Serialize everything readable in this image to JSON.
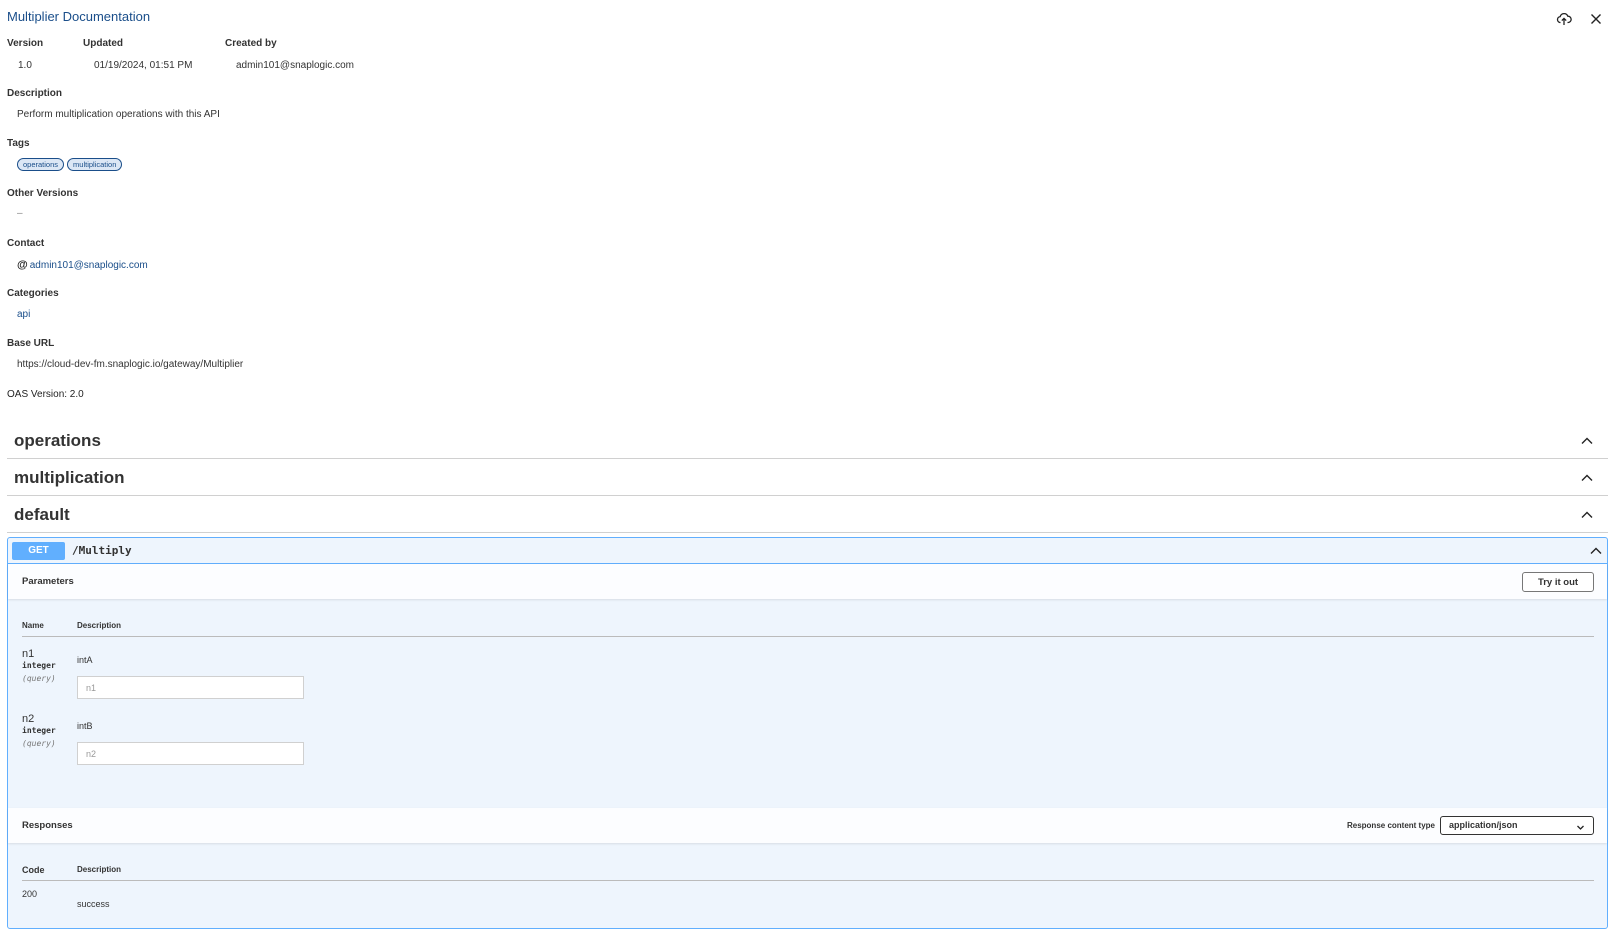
{
  "header": {
    "title": "Multiplier Documentation",
    "icons": [
      "cloud-upload-icon",
      "close-icon"
    ]
  },
  "meta": {
    "version_label": "Version",
    "version": "1.0",
    "updated_label": "Updated",
    "updated": "01/19/2024, 01:51 PM",
    "created_label": "Created by",
    "created_by": "admin101@snaplogic.com"
  },
  "description": {
    "label": "Description",
    "text": "Perform multiplication operations with this API"
  },
  "tags": {
    "label": "Tags",
    "items": [
      "operations",
      "multiplication"
    ]
  },
  "other_versions": {
    "label": "Other Versions",
    "value": "–"
  },
  "contact": {
    "label": "Contact",
    "icon": "at-icon",
    "email": "admin101@snaplogic.com"
  },
  "categories": {
    "label": "Categories",
    "value": "api"
  },
  "base_url": {
    "label": "Base URL",
    "value": "https://cloud-dev-fm.snaplogic.io/gateway/Multiplier"
  },
  "oas": "OAS Version: 2.0",
  "groups": [
    "operations",
    "multiplication",
    "default"
  ],
  "operation": {
    "method": "GET",
    "path": "/Multiply",
    "method_color": "#61affe",
    "parameters_title": "Parameters",
    "try_label": "Try it out",
    "col_name": "Name",
    "col_desc": "Description",
    "params": [
      {
        "name": "n1",
        "type": "integer",
        "in": "(query)",
        "desc": "intA",
        "placeholder": "n1"
      },
      {
        "name": "n2",
        "type": "integer",
        "in": "(query)",
        "desc": "intB",
        "placeholder": "n2"
      }
    ],
    "responses_title": "Responses",
    "content_type_label": "Response content type",
    "content_type": "application/json",
    "col_code": "Code",
    "responses": [
      {
        "code": "200",
        "desc": "success"
      }
    ]
  }
}
